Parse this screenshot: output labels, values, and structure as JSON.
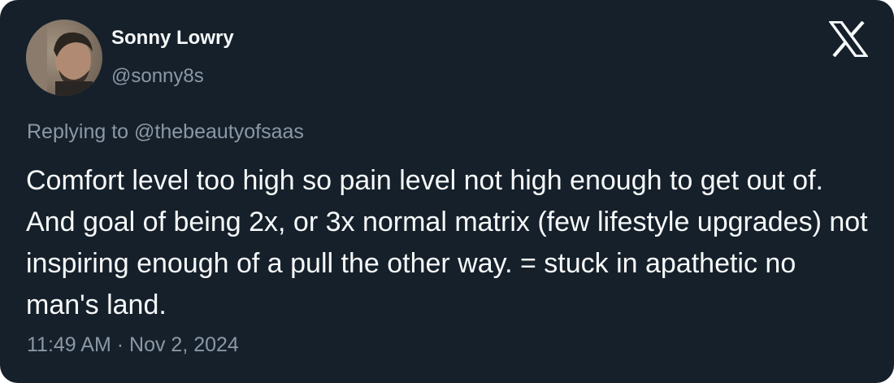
{
  "author": {
    "name": "Sonny Lowry",
    "handle": "@sonny8s",
    "avatar_icon": "profile-photo"
  },
  "brand": {
    "logo_icon": "x-logo-icon"
  },
  "tweet": {
    "reply_prefix": "Replying to",
    "reply_to": "@thebeautyofsaas",
    "text": "Comfort level too high so pain level not high enough to get out of. And goal of being 2x, or 3x normal matrix (few lifestyle upgrades) not inspiring enough of a pull the other way. = stuck in apathetic no man's land.",
    "time": "11:49 AM",
    "separator": "·",
    "date": "Nov 2, 2024"
  },
  "colors": {
    "background": "#15202b",
    "text_primary": "#f7f9f9",
    "text_secondary": "#8b98a5"
  }
}
